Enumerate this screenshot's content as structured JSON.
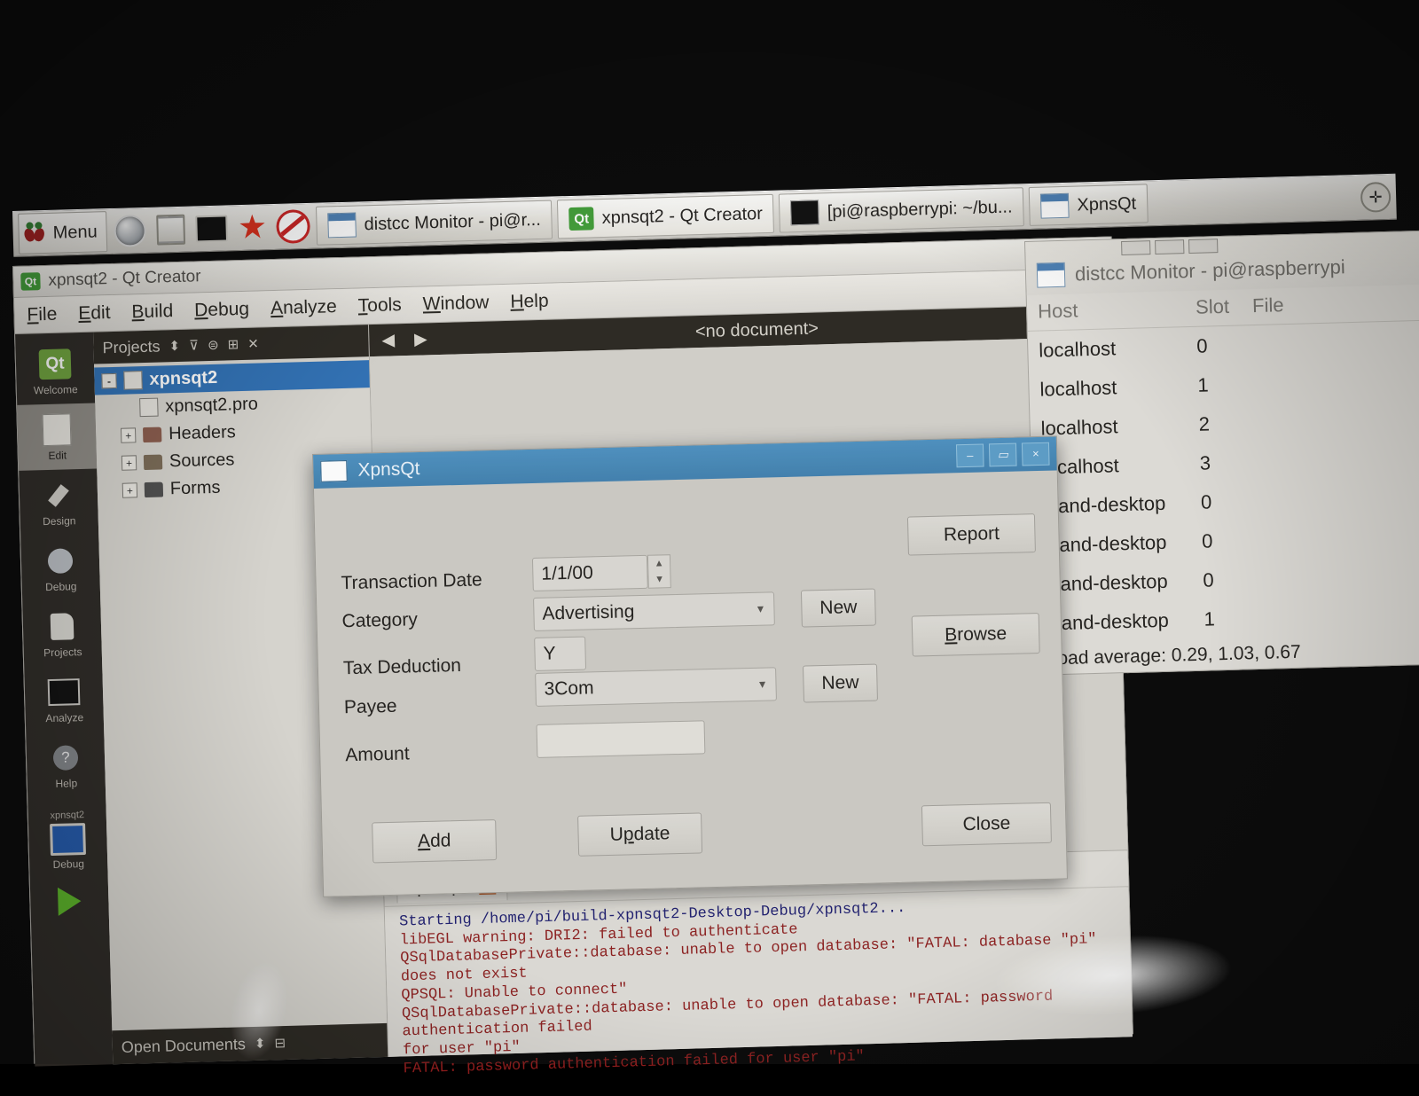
{
  "taskbar": {
    "menu_label": "Menu",
    "launchers": [
      "globe-icon",
      "files-icon",
      "terminal-icon",
      "star-icon",
      "ban-icon"
    ],
    "tasks": [
      {
        "label": "distcc Monitor - pi@r...",
        "icon": "window-icon"
      },
      {
        "label": "xpnsqt2 - Qt Creator",
        "icon": "qt-icon"
      },
      {
        "label": "[pi@raspberrypi: ~/bu...",
        "icon": "terminal-icon"
      },
      {
        "label": "XpnsQt",
        "icon": "window-icon"
      }
    ],
    "tray": [
      "bluetooth-icon"
    ]
  },
  "qtcreator": {
    "title": "xpnsqt2 - Qt Creator",
    "menus": [
      {
        "pre": "",
        "key": "F",
        "post": "ile"
      },
      {
        "pre": "",
        "key": "E",
        "post": "dit"
      },
      {
        "pre": "",
        "key": "B",
        "post": "uild"
      },
      {
        "pre": "",
        "key": "D",
        "post": "ebug"
      },
      {
        "pre": "",
        "key": "A",
        "post": "nalyze"
      },
      {
        "pre": "",
        "key": "T",
        "post": "ools"
      },
      {
        "pre": "",
        "key": "W",
        "post": "indow"
      },
      {
        "pre": "",
        "key": "H",
        "post": "elp"
      }
    ],
    "modes": [
      {
        "label": "Welcome",
        "icon": "qt-logo-icon",
        "selected": false
      },
      {
        "label": "Edit",
        "icon": "edit-icon",
        "selected": true
      },
      {
        "label": "Design",
        "icon": "design-icon",
        "selected": false
      },
      {
        "label": "Debug",
        "icon": "debug-icon",
        "selected": false
      },
      {
        "label": "Projects",
        "icon": "projects-icon",
        "selected": false
      },
      {
        "label": "Analyze",
        "icon": "analyze-icon",
        "selected": false
      },
      {
        "label": "Help",
        "icon": "help-icon",
        "selected": false
      }
    ],
    "kit": {
      "project": "xpnsqt2",
      "config": "Debug"
    },
    "panel_title": "Projects",
    "open_documents_title": "Open Documents",
    "editor_document": "<no document>",
    "tree": [
      {
        "label": "xpnsqt2",
        "icon": "project-icon",
        "selected": true,
        "expander": "-",
        "indent": 0
      },
      {
        "label": "xpnsqt2.pro",
        "icon": "pro-file-icon",
        "selected": false,
        "expander": "",
        "indent": 1
      },
      {
        "label": "Headers",
        "icon": "folder-headers-icon",
        "selected": false,
        "expander": "+",
        "indent": 1
      },
      {
        "label": "Sources",
        "icon": "folder-sources-icon",
        "selected": false,
        "expander": "+",
        "indent": 1
      },
      {
        "label": "Forms",
        "icon": "folder-forms-icon",
        "selected": false,
        "expander": "+",
        "indent": 1
      }
    ],
    "output": {
      "tab_label": "xpnsqt2",
      "lines": [
        "Starting /home/pi/build-xpnsqt2-Desktop-Debug/xpnsqt2...",
        "libEGL warning: DRI2: failed to authenticate",
        "QSqlDatabasePrivate::database: unable to open database: \"FATAL:  database \"pi\" does not exist",
        "QPSQL: Unable to connect\"",
        "QSqlDatabasePrivate::database: unable to open database: \"FATAL:  password authentication failed",
        "for user \"pi\"",
        "FATAL:  password authentication failed for user \"pi\""
      ]
    }
  },
  "distcc": {
    "title": "distcc Monitor - pi@raspberrypi",
    "columns": [
      "Host",
      "Slot",
      "File"
    ],
    "rows": [
      {
        "host": "localhost",
        "slot": "0",
        "file": ""
      },
      {
        "host": "localhost",
        "slot": "1",
        "file": ""
      },
      {
        "host": "localhost",
        "slot": "2",
        "file": ""
      },
      {
        "host": "localhost",
        "slot": "3",
        "file": ""
      },
      {
        "host": "bland-desktop",
        "slot": "0",
        "file": ""
      },
      {
        "host": "bland-desktop",
        "slot": "0",
        "file": ""
      },
      {
        "host": "bland-desktop",
        "slot": "0",
        "file": ""
      },
      {
        "host": "bland-desktop",
        "slot": "1",
        "file": ""
      }
    ],
    "load_average": "Load average: 0.29, 1.03, 0.67"
  },
  "dialog": {
    "title": "XpnsQt",
    "window_buttons": [
      "–",
      "▭",
      "×"
    ],
    "fields": {
      "transaction_date": {
        "label": "Transaction Date",
        "value": "1/1/00"
      },
      "category": {
        "label": "Category",
        "value": "Advertising"
      },
      "tax_deduction": {
        "label": "Tax Deduction",
        "value": "Y"
      },
      "payee": {
        "label": "Payee",
        "value": "3Com"
      },
      "amount": {
        "label": "Amount",
        "value": ""
      }
    },
    "buttons": {
      "report": "Report",
      "browse_pre": "",
      "browse_key": "B",
      "browse_post": "rowse",
      "new_category": "New",
      "new_payee": "New",
      "add_pre": "",
      "add_key": "A",
      "add_post": "dd",
      "update_pre": "U",
      "update_key": "p",
      "update_post": "date",
      "close": "Close"
    }
  },
  "colors": {
    "dialog_titlebar": "#4b90c0",
    "tree_selection": "#2d6fb5",
    "error_text": "#8c1c1c",
    "qt_green": "#6ea43c"
  }
}
